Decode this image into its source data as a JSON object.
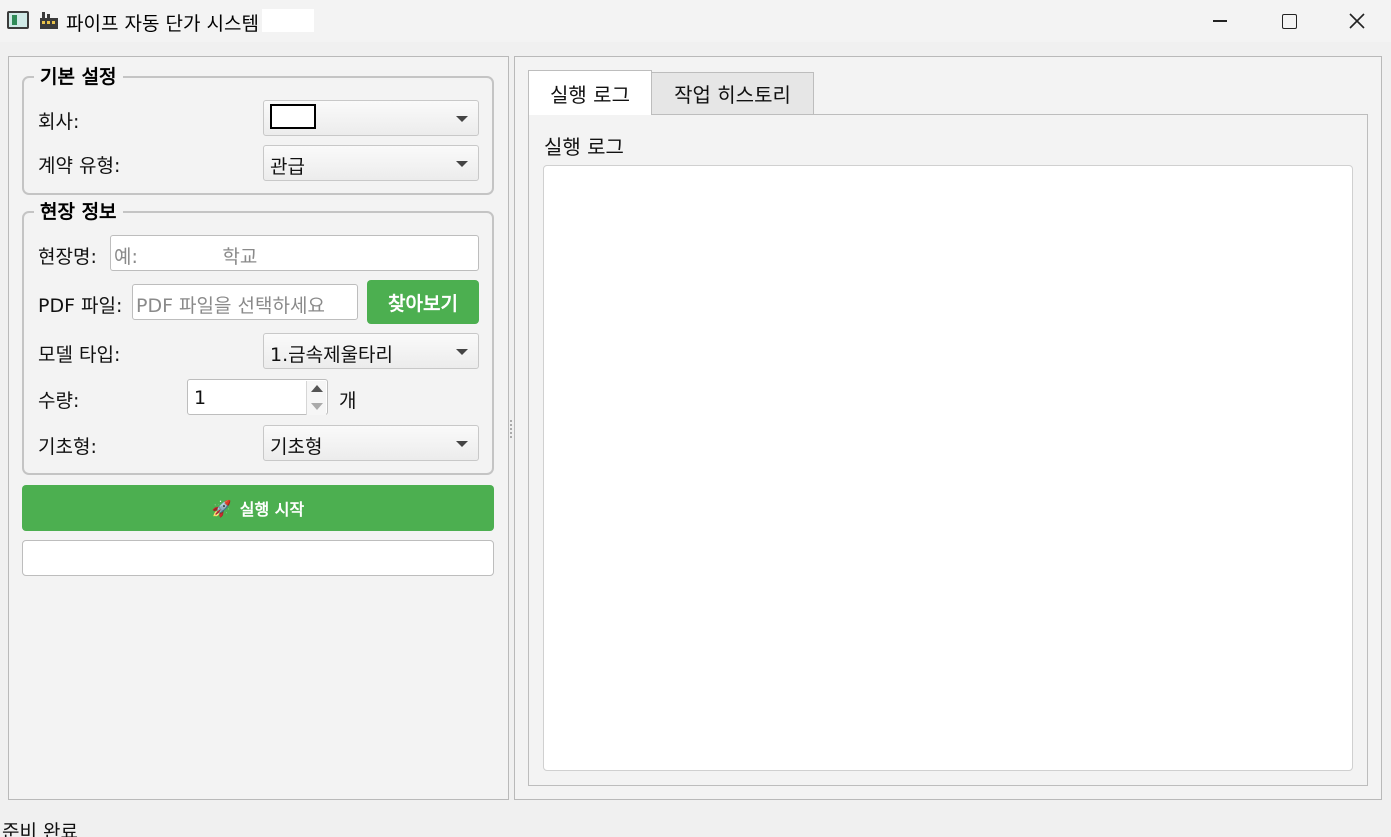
{
  "window": {
    "title": "파이프 자동 단가 시스템",
    "title_emoji": "🏭"
  },
  "basic_settings": {
    "title": "기본 설정",
    "company_label": "회사:",
    "company_value": "",
    "contract_label": "계약 유형:",
    "contract_value": "관급"
  },
  "site_info": {
    "title": "현장 정보",
    "site_name_label": "현장명:",
    "site_name_placeholder": "예:              학교",
    "pdf_label": "PDF 파일:",
    "pdf_placeholder": "PDF 파일을 선택하세요",
    "browse_label": "찾아보기",
    "model_label": "모델 타입:",
    "model_value": "1.금속제울타리",
    "qty_label": "수량:",
    "qty_value": "1",
    "qty_unit": "개",
    "foundation_label": "기초형:",
    "foundation_value": "기초형"
  },
  "run": {
    "icon": "🚀",
    "label": "실행 시작"
  },
  "progress": {
    "value": 0
  },
  "tabs": [
    {
      "label": "실행 로그",
      "active": true
    },
    {
      "label": "작업 히스토리",
      "active": false
    }
  ],
  "log": {
    "title": "실행 로그",
    "content": ""
  },
  "status_bar": {
    "text": "준비 완료"
  },
  "colors": {
    "accent": "#4caf50"
  }
}
